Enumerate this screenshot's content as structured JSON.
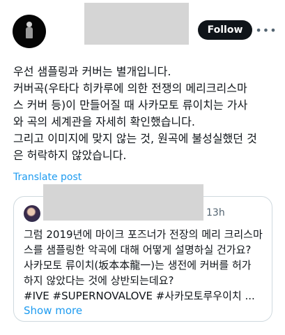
{
  "header": {
    "follow_label": "Follow",
    "more_icon": "more-horizontal-icon"
  },
  "post": {
    "lines": [
      "우선 샘플링과 커버는 별개입니다.",
      "커버곡(우타다 히카루에 의한 전쟁의 메리크리스마",
      "스 커버 등)이 만들어질 때 사카모토 류이치는 가사",
      "와 곡의 세계관을 자세히 확인했습니다.",
      "그리고 이미지에 맞지 않는 것, 원곡에 불성실했던 것",
      "은 허락하지 않았습니다."
    ],
    "translate_label": "Translate post"
  },
  "quote": {
    "time": "13h",
    "lines": [
      "그럼 2019년에 마이크 포즈너가 전장의 메리 크리스마",
      "스를 샘플링한 악곡에 대해 어떻게 설명하실 건가요?",
      "사카모토 류이치(坂本本龍一)는 생전에 커버를 허가",
      "하지 않았다는 것에 상반되는데요?",
      "#IVE #SUPERNOVALOVE  #사카모토루우이치 ..."
    ],
    "show_more_label": "Show more"
  }
}
